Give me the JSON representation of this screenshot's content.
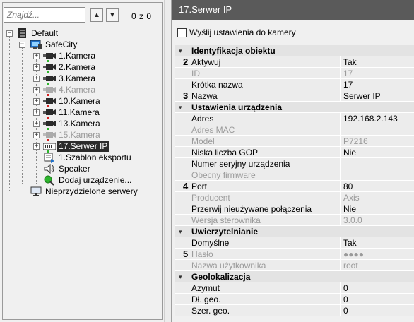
{
  "tree_panel": {
    "search_placeholder": "Znajdź...",
    "prev_label": "▲",
    "next_label": "▼",
    "counter": "0 z 0",
    "items": [
      {
        "label": "Default",
        "icon": "server-icon",
        "disabled": false
      },
      {
        "label": "SafeCity",
        "icon": "computer-icon",
        "disabled": false
      },
      {
        "label": "1.Kamera",
        "icon": "camera-icon",
        "disabled": false
      },
      {
        "label": "2.Kamera",
        "icon": "camera-icon",
        "disabled": false
      },
      {
        "label": "3.Kamera",
        "icon": "camera-icon",
        "disabled": false
      },
      {
        "label": "4.Kamera",
        "icon": "camera-icon",
        "disabled": true
      },
      {
        "label": "10.Kamera",
        "icon": "camera-icon",
        "disabled": false
      },
      {
        "label": "11.Kamera",
        "icon": "camera-icon",
        "disabled": false
      },
      {
        "label": "13.Kamera",
        "icon": "camera-icon",
        "disabled": false
      },
      {
        "label": "15.Kamera",
        "icon": "camera-icon",
        "disabled": true
      },
      {
        "label": "17.Serwer IP",
        "icon": "ip-server-icon",
        "disabled": false,
        "selected": true
      },
      {
        "label": "1.Szablon eksportu",
        "icon": "export-template-icon",
        "disabled": false
      },
      {
        "label": "Speaker",
        "icon": "speaker-icon",
        "disabled": false
      },
      {
        "label": "Dodaj urządzenie...",
        "icon": "add-device-icon",
        "disabled": false
      },
      {
        "label": "Nieprzydzielone serwery",
        "icon": "monitor-icon",
        "disabled": false
      }
    ]
  },
  "properties_panel": {
    "title": "17.Serwer IP",
    "send_settings_label": "Wyślij ustawienia do kamery",
    "send_settings_checked": false,
    "sections": [
      {
        "title": "Identyfikacja obiektu",
        "rows": [
          {
            "marker": "2",
            "key": "Aktywuj",
            "value": "Tak",
            "gray": false
          },
          {
            "marker": "",
            "key": "ID",
            "value": "17",
            "gray": true
          },
          {
            "marker": "",
            "key": "Krótka nazwa",
            "value": "17",
            "gray": false
          },
          {
            "marker": "3",
            "key": "Nazwa",
            "value": "Serwer IP",
            "gray": false
          }
        ]
      },
      {
        "title": "Ustawienia urządzenia",
        "rows": [
          {
            "marker": "",
            "key": "Adres",
            "value": "192.168.2.143",
            "gray": false
          },
          {
            "marker": "",
            "key": "Adres MAC",
            "value": "",
            "gray": true
          },
          {
            "marker": "",
            "key": "Model",
            "value": "P7216",
            "gray": true
          },
          {
            "marker": "",
            "key": "Niska liczba GOP",
            "value": "Nie",
            "gray": false
          },
          {
            "marker": "",
            "key": "Numer seryjny urządzenia",
            "value": "",
            "gray": false
          },
          {
            "marker": "",
            "key": "Obecny firmware",
            "value": "",
            "gray": true
          },
          {
            "marker": "4",
            "key": "Port",
            "value": "80",
            "gray": false
          },
          {
            "marker": "",
            "key": "Producent",
            "value": "Axis",
            "gray": true
          },
          {
            "marker": "",
            "key": "Przerwij nieużywane połączenia",
            "value": "Nie",
            "gray": false
          },
          {
            "marker": "",
            "key": "Wersja sterownika",
            "value": "3.0.0",
            "gray": true
          }
        ]
      },
      {
        "title": "Uwierzytelnianie",
        "rows": [
          {
            "marker": "",
            "key": "Domyślne",
            "value": "Tak",
            "gray": false
          },
          {
            "marker": "5",
            "key": "Hasło",
            "value": "●●●●",
            "gray": true
          },
          {
            "marker": "",
            "key": "Nazwa użytkownika",
            "value": "root",
            "gray": true
          }
        ]
      },
      {
        "title": "Geolokalizacja",
        "rows": [
          {
            "marker": "",
            "key": "Azymut",
            "value": "0",
            "gray": false
          },
          {
            "marker": "",
            "key": "Dł. geo.",
            "value": "0",
            "gray": false
          },
          {
            "marker": "",
            "key": "Szer. geo.",
            "value": "0",
            "gray": false
          }
        ]
      }
    ]
  },
  "colors": {
    "title_bar": "#5a5a5a",
    "selected_item": "#2b2b2b",
    "status_green": "#2db52d",
    "status_red": "#d42020"
  }
}
